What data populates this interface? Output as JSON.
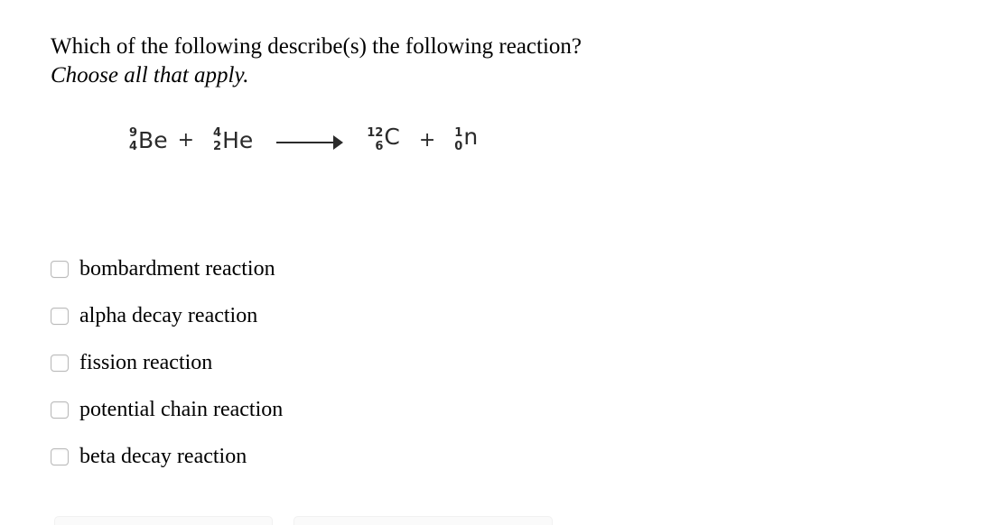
{
  "prompt": {
    "line1": "Which of the following describe(s) the following reaction?",
    "line2": "Choose all that apply."
  },
  "equation": {
    "reactant_1": {
      "mass": "9",
      "atomic": "4",
      "symbol": "Be"
    },
    "plus_1": "+",
    "reactant_2": {
      "mass": "4",
      "atomic": "2",
      "symbol": "He"
    },
    "arrow": "→",
    "product_1": {
      "mass": "12",
      "atomic": "6",
      "symbol": "C"
    },
    "plus_2": "+",
    "product_2": {
      "mass": "1",
      "atomic": "0",
      "symbol": "n"
    }
  },
  "options": [
    {
      "label": "bombardment reaction",
      "checked": false
    },
    {
      "label": "alpha decay reaction",
      "checked": false
    },
    {
      "label": "fission reaction",
      "checked": false
    },
    {
      "label": "potential chain reaction",
      "checked": false
    },
    {
      "label": "beta decay reaction",
      "checked": false
    }
  ],
  "colors": {
    "background": "#ffffff",
    "text": "#000000",
    "equation_ink": "#2b2b2b",
    "checkbox_border": "#b9b9b9",
    "bottom_bar": "#fafafa"
  }
}
